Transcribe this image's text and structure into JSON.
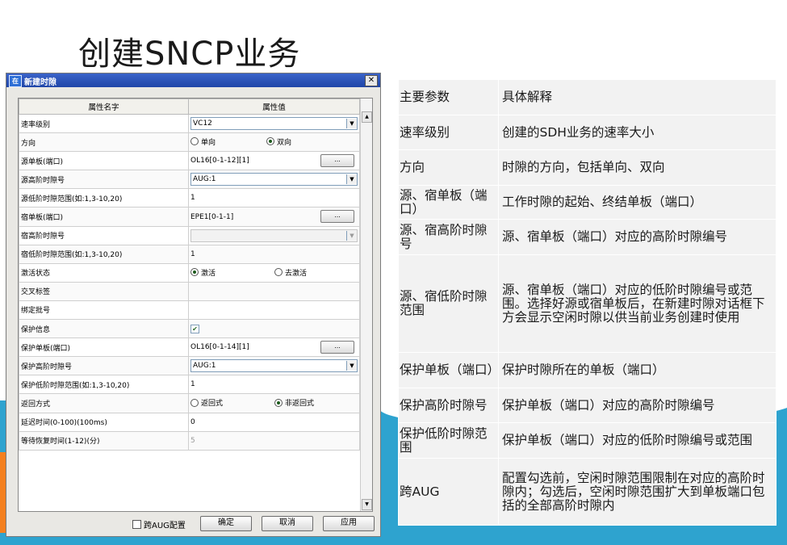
{
  "slide": {
    "title": "创建SNCP业务"
  },
  "dialog": {
    "title": "新建时隙",
    "icon_text": "在",
    "close_glyph": "✕",
    "headers": {
      "name": "属性名字",
      "value": "属性值"
    },
    "rows": [
      {
        "name": "速率级别",
        "value": "VC12"
      },
      {
        "name": "方向",
        "opt1": "单向",
        "opt2": "双向"
      },
      {
        "name": "源单板(端口)",
        "value": "OL16[0-1-12][1]",
        "btn": "..."
      },
      {
        "name": "源高阶时隙号",
        "value": "AUG:1"
      },
      {
        "name": "源低阶时隙范围(如:1,3-10,20)",
        "value": "1"
      },
      {
        "name": "宿单板(端口)",
        "value": "EPE1[0-1-1]",
        "btn": "..."
      },
      {
        "name": "宿高阶时隙号",
        "value": ""
      },
      {
        "name": "宿低阶时隙范围(如:1,3-10,20)",
        "value": "1"
      },
      {
        "name": "激活状态",
        "opt1": "激活",
        "opt2": "去激活"
      },
      {
        "name": "交叉标签",
        "value": ""
      },
      {
        "name": "绑定批号",
        "value": ""
      },
      {
        "name": "保护信息",
        "check": "✔"
      },
      {
        "name": "保护单板(端口)",
        "value": "OL16[0-1-14][1]",
        "btn": "..."
      },
      {
        "name": "保护高阶时隙号",
        "value": "AUG:1"
      },
      {
        "name": "保护低阶时隙范围(如:1,3-10,20)",
        "value": "1"
      },
      {
        "name": "返回方式",
        "opt1": "返回式",
        "opt2": "非返回式"
      },
      {
        "name": "延迟时间(0-100)(100ms)",
        "value": "0"
      },
      {
        "name": "等待恢复时间(1-12)(分)",
        "value": "5"
      }
    ],
    "aug_label": "跨AUG配置",
    "ok": "确定",
    "cancel": "取消",
    "apply": "应用"
  },
  "info_table": {
    "header": {
      "k": "主要参数",
      "v": "具体解释"
    },
    "rows": [
      {
        "k": "速率级别",
        "v": "创建的SDH业务的速率大小"
      },
      {
        "k": "方向",
        "v": "时隙的方向，包括单向、双向"
      },
      {
        "k": "源、宿单板（端口）",
        "v": "工作时隙的起始、终结单板（端口）"
      },
      {
        "k": "源、宿高阶时隙号",
        "v": "源、宿单板（端口）对应的高阶时隙编号"
      },
      {
        "k": "源、宿低阶时隙范围",
        "v": "源、宿单板（端口）对应的低阶时隙编号或范围。选择好源或宿单板后，在新建时隙对话框下方会显示空闲时隙以供当前业务创建时使用"
      },
      {
        "k": "保护单板（端口）",
        "v": "保护时隙所在的单板（端口）"
      },
      {
        "k": "保护高阶时隙号",
        "v": "保护单板（端口）对应的高阶时隙编号"
      },
      {
        "k": "保护低阶时隙范围",
        "v": "保护单板（端口）对应的低阶时隙编号或范围"
      },
      {
        "k": "跨AUG",
        "v": "配置勾选前，空闲时隙范围限制在对应的高阶时隙内；勾选后，空闲时隙范围扩大到单板端口包括的全部高阶时隙内"
      }
    ]
  },
  "colors": {
    "band": "#2ea3cf",
    "accent": "#f4801f",
    "titlebar": "#2b55b8"
  }
}
